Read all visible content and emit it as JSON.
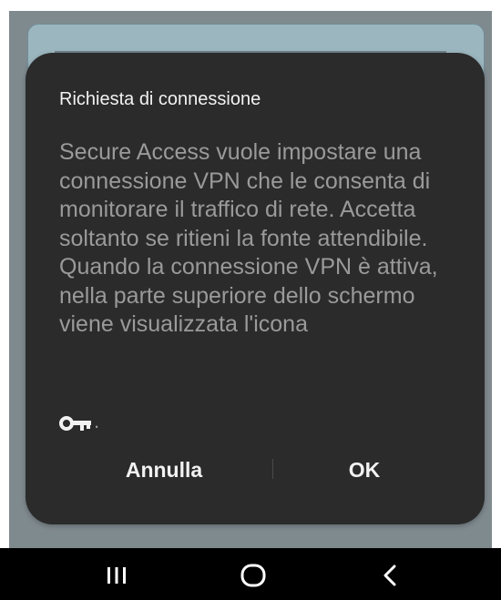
{
  "dialog": {
    "title": "Richiesta di connessione",
    "message": "Secure Access vuole impostare una connessione VPN che le consenta di monitorare il traffico di rete. Accetta soltanto se ritieni la fonte attendibile. Quando la connessione VPN è attiva, nella parte superiore dello schermo viene visualizzata l'icona",
    "key_icon": "vpn-key-icon",
    "key_suffix": ".",
    "cancel_label": "Annulla",
    "ok_label": "OK"
  },
  "navigation_bar": {
    "recent_icon": "recent-apps-icon",
    "home_icon": "home-icon",
    "back_icon": "back-icon"
  },
  "colors": {
    "dialog_bg": "#2b2b2b",
    "title": "#f2f2f2",
    "body_text": "#9a9a9a",
    "navbar_bg": "#000000"
  }
}
